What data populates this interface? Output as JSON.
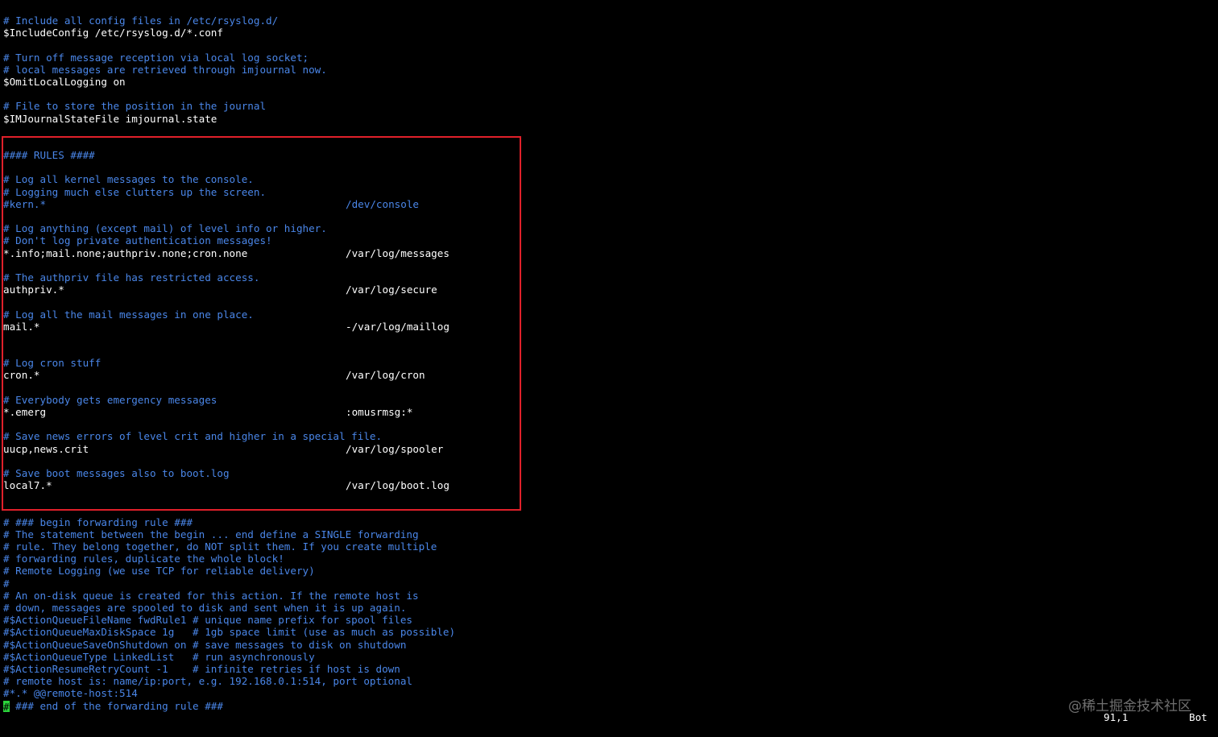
{
  "lines": [
    {
      "kind": "comment",
      "text": "# Include all config files in /etc/rsyslog.d/"
    },
    {
      "kind": "code",
      "text": "$IncludeConfig /etc/rsyslog.d/*.conf"
    },
    {
      "kind": "blank",
      "text": ""
    },
    {
      "kind": "comment",
      "text": "# Turn off message reception via local log socket;"
    },
    {
      "kind": "comment",
      "text": "# local messages are retrieved through imjournal now."
    },
    {
      "kind": "code",
      "text": "$OmitLocalLogging on"
    },
    {
      "kind": "blank",
      "text": ""
    },
    {
      "kind": "comment",
      "text": "# File to store the position in the journal"
    },
    {
      "kind": "code",
      "text": "$IMJournalStateFile imjournal.state"
    },
    {
      "kind": "blank",
      "text": ""
    },
    {
      "kind": "blank",
      "text": ""
    },
    {
      "kind": "comment",
      "text": "#### RULES ####"
    },
    {
      "kind": "blank",
      "text": ""
    },
    {
      "kind": "comment",
      "text": "# Log all kernel messages to the console."
    },
    {
      "kind": "comment",
      "text": "# Logging much else clutters up the screen."
    },
    {
      "kind": "comment",
      "text": "#kern.*",
      "dest": "/dev/console"
    },
    {
      "kind": "blank",
      "text": ""
    },
    {
      "kind": "comment",
      "text": "# Log anything (except mail) of level info or higher."
    },
    {
      "kind": "comment",
      "text": "# Don't log private authentication messages!"
    },
    {
      "kind": "code",
      "text": "*.info;mail.none;authpriv.none;cron.none",
      "dest": "/var/log/messages"
    },
    {
      "kind": "blank",
      "text": ""
    },
    {
      "kind": "comment",
      "text": "# The authpriv file has restricted access."
    },
    {
      "kind": "code",
      "text": "authpriv.*",
      "dest": "/var/log/secure"
    },
    {
      "kind": "blank",
      "text": ""
    },
    {
      "kind": "comment",
      "text": "# Log all the mail messages in one place."
    },
    {
      "kind": "code",
      "text": "mail.*",
      "dest": "-/var/log/maillog"
    },
    {
      "kind": "blank",
      "text": ""
    },
    {
      "kind": "blank",
      "text": ""
    },
    {
      "kind": "comment",
      "text": "# Log cron stuff"
    },
    {
      "kind": "code",
      "text": "cron.*",
      "dest": "/var/log/cron"
    },
    {
      "kind": "blank",
      "text": ""
    },
    {
      "kind": "comment",
      "text": "# Everybody gets emergency messages"
    },
    {
      "kind": "code",
      "text": "*.emerg",
      "dest": ":omusrmsg:*"
    },
    {
      "kind": "blank",
      "text": ""
    },
    {
      "kind": "comment",
      "text": "# Save news errors of level crit and higher in a special file."
    },
    {
      "kind": "code",
      "text": "uucp,news.crit",
      "dest": "/var/log/spooler"
    },
    {
      "kind": "blank",
      "text": ""
    },
    {
      "kind": "comment",
      "text": "# Save boot messages also to boot.log"
    },
    {
      "kind": "code",
      "text": "local7.*",
      "dest": "/var/log/boot.log"
    },
    {
      "kind": "blank",
      "text": ""
    },
    {
      "kind": "blank",
      "text": ""
    },
    {
      "kind": "comment",
      "text": "# ### begin forwarding rule ###"
    },
    {
      "kind": "comment",
      "text": "# The statement between the begin ... end define a SINGLE forwarding"
    },
    {
      "kind": "comment",
      "text": "# rule. They belong together, do NOT split them. If you create multiple"
    },
    {
      "kind": "comment",
      "text": "# forwarding rules, duplicate the whole block!"
    },
    {
      "kind": "comment",
      "text": "# Remote Logging (we use TCP for reliable delivery)"
    },
    {
      "kind": "comment",
      "text": "#"
    },
    {
      "kind": "comment",
      "text": "# An on-disk queue is created for this action. If the remote host is"
    },
    {
      "kind": "comment",
      "text": "# down, messages are spooled to disk and sent when it is up again."
    },
    {
      "kind": "comment",
      "text": "#$ActionQueueFileName fwdRule1 # unique name prefix for spool files"
    },
    {
      "kind": "comment",
      "text": "#$ActionQueueMaxDiskSpace 1g   # 1gb space limit (use as much as possible)"
    },
    {
      "kind": "comment",
      "text": "#$ActionQueueSaveOnShutdown on # save messages to disk on shutdown"
    },
    {
      "kind": "comment",
      "text": "#$ActionQueueType LinkedList   # run asynchronously"
    },
    {
      "kind": "comment",
      "text": "#$ActionResumeRetryCount -1    # infinite retries if host is down"
    },
    {
      "kind": "comment",
      "text": "# remote host is: name/ip:port, e.g. 192.168.0.1:514, port optional"
    },
    {
      "kind": "comment",
      "text": "#*.* @@remote-host:514"
    },
    {
      "kind": "cursorline",
      "cursor": "#",
      "text": " ### end of the forwarding rule ###"
    }
  ],
  "status": {
    "position": "91,1",
    "scroll": "Bot"
  },
  "watermark": "@稀土掘金技术社区",
  "colors": {
    "background": "#000000",
    "comment": "#4a86e8",
    "code": "#ffffff",
    "cursor": "#2bd43b",
    "highlight_box": "#e0202a"
  }
}
